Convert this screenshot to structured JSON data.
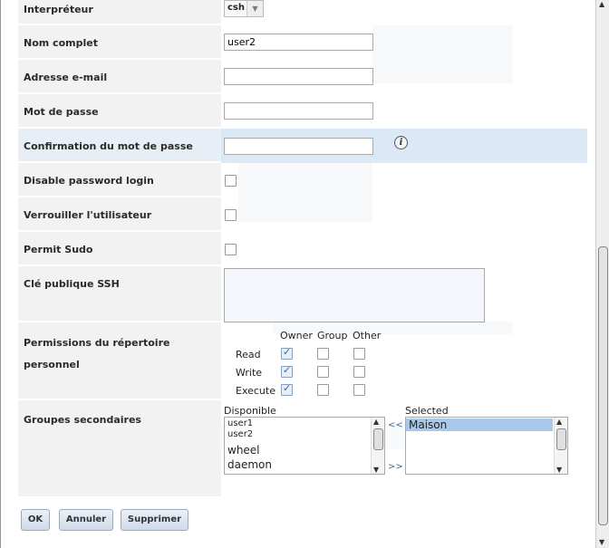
{
  "form": {
    "shell": {
      "label": "Interpréteur",
      "value": "csh"
    },
    "fullname": {
      "label": "Nom complet",
      "value": "user2"
    },
    "email": {
      "label": "Adresse e-mail",
      "value": ""
    },
    "password": {
      "label": "Mot de passe",
      "value": ""
    },
    "password_confirm": {
      "label": "Confirmation du mot de passe",
      "value": "",
      "info_icon": "info-icon"
    },
    "disable_password": {
      "label": "Disable password login",
      "checked": false
    },
    "lock_user": {
      "label": "Verrouiller l'utilisateur",
      "checked": false
    },
    "permit_sudo": {
      "label": "Permit Sudo",
      "checked": false
    },
    "ssh_key": {
      "label": "Clé publique SSH",
      "value": ""
    },
    "home_perms": {
      "label_line1": "Permissions du répertoire",
      "label_line2": "personnel",
      "columns": [
        "Owner",
        "Group",
        "Other"
      ],
      "rows": [
        {
          "name": "Read",
          "values": [
            true,
            false,
            false
          ]
        },
        {
          "name": "Write",
          "values": [
            true,
            false,
            false
          ]
        },
        {
          "name": "Execute",
          "values": [
            true,
            false,
            false
          ]
        }
      ]
    },
    "groups": {
      "label": "Groupes secondaires",
      "available_title": "Disponible",
      "selected_title": "Selected",
      "available": [
        "user1",
        "user2",
        "wheel",
        "daemon"
      ],
      "selected": [
        "Maison"
      ],
      "add_label": "<<",
      "remove_label": ">>"
    }
  },
  "buttons": {
    "ok": "OK",
    "cancel": "Annuler",
    "delete": "Supprimer"
  }
}
